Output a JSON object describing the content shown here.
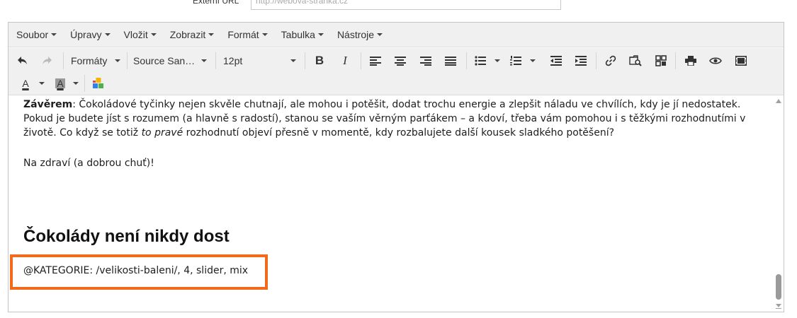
{
  "url_field": {
    "label": "Externí URL",
    "placeholder": "http://webova-stranka.cz"
  },
  "menubar": {
    "items": [
      "Soubor",
      "Úpravy",
      "Vložit",
      "Zobrazit",
      "Formát",
      "Tabulka",
      "Nástroje"
    ]
  },
  "toolbar": {
    "formats_label": "Formáty",
    "font_family": "Source San…",
    "font_size": "12pt",
    "bold_label": "B",
    "italic_label": "I",
    "text_color_label": "A",
    "bg_color_label": "A",
    "icons": [
      "undo-icon",
      "redo-icon",
      "bold-icon",
      "italic-icon",
      "align-left-icon",
      "align-center-icon",
      "align-right-icon",
      "align-justify-icon",
      "bullet-list-icon",
      "numbered-list-icon",
      "outdent-icon",
      "indent-icon",
      "link-icon",
      "find-replace-icon",
      "widget-icon",
      "print-icon",
      "preview-icon",
      "media-icon",
      "text-color-icon",
      "background-color-icon",
      "plugin-blocks-icon"
    ],
    "colors": {
      "text_underline": "#000000",
      "bg_underline": "#555555",
      "block_red": "#e34a3b",
      "block_yellow": "#f4b400",
      "block_green": "#4caf50",
      "block_blue": "#2f80ed"
    }
  },
  "content": {
    "p1_bold": "Závěrem",
    "p1_text_a": ": Čokoládové tyčinky nejen skvěle chutnají, ale mohou i potěšit, dodat trochu energie a zlepšit náladu ve chvílích, kdy je jí nedostatek. Pokud je budete jíst s rozumem (a hlavně s radostí), stanou se vaším věrným parťákem – a kdoví, třeba vám pomohou i s těžkými rozhodnutími v životě. Co když se totiž ",
    "p1_italic": "to pravé",
    "p1_text_b": " rozhodnutí objeví přesně v momentě, kdy rozbalujete další kousek sladkého potěšení?",
    "p2": "Na zdraví (a dobrou chuť)!",
    "heading": "Čokolády není nikdy dost",
    "category_line": "@KATEGORIE: /velikosti-baleni/, 4, slider, mix",
    "highlight_color": "#f26b1d"
  }
}
